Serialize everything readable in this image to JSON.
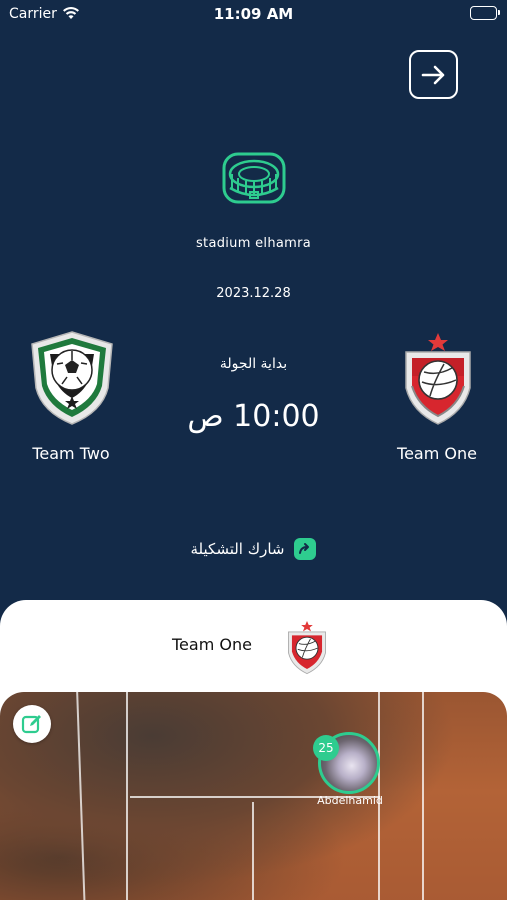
{
  "status_bar": {
    "carrier": "Carrier",
    "time": "11:09 AM"
  },
  "match": {
    "stadium": "stadium  elhamra",
    "date": "2023.12.28",
    "round_label": "بداية الجولة",
    "time": "10:00 ص",
    "team_two": "Team Two",
    "team_one": "Team One"
  },
  "share": {
    "label": "شارك التشكيلة"
  },
  "lineup": {
    "team_name": "Team One",
    "players": [
      {
        "number": "25",
        "name": "Abdelhamid"
      }
    ]
  },
  "colors": {
    "background": "#132a48",
    "accent": "#2ecc8f",
    "card": "#ffffff"
  }
}
